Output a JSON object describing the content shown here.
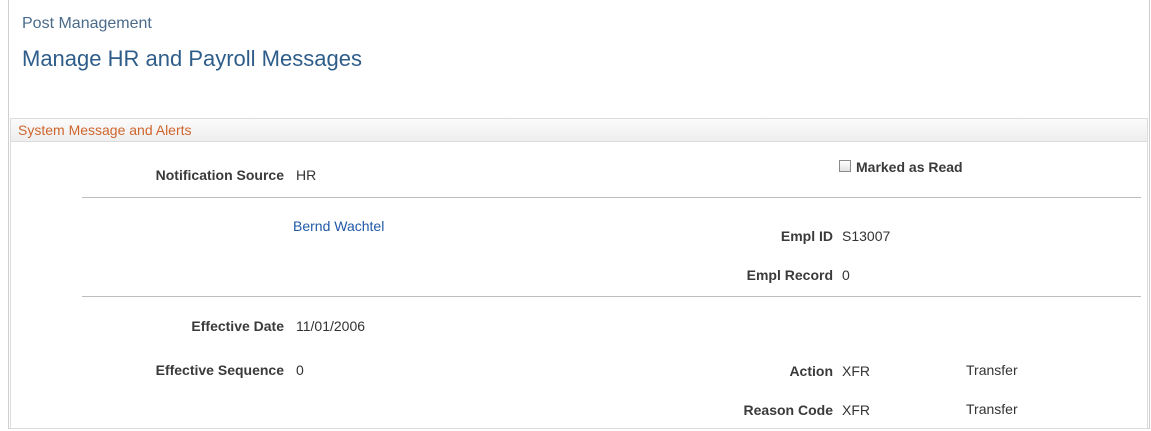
{
  "header": {
    "breadcrumb": "Post Management",
    "title": "Manage HR and Payroll Messages"
  },
  "section": {
    "title": "System Message and Alerts"
  },
  "notification": {
    "source_label": "Notification Source",
    "source_value": "HR",
    "marked_as_read_label": "Marked as Read",
    "marked_as_read": false
  },
  "employee": {
    "name": "Bernd Wachtel",
    "empl_id_label": "Empl ID",
    "empl_id_value": "S13007",
    "empl_record_label": "Empl Record",
    "empl_record_value": "0"
  },
  "details": {
    "effective_date_label": "Effective Date",
    "effective_date_value": "11/01/2006",
    "effective_sequence_label": "Effective Sequence",
    "effective_sequence_value": "0",
    "action_label": "Action",
    "action_code": "XFR",
    "action_desc": "Transfer",
    "reason_code_label": "Reason Code",
    "reason_code": "XFR",
    "reason_desc": "Transfer"
  }
}
